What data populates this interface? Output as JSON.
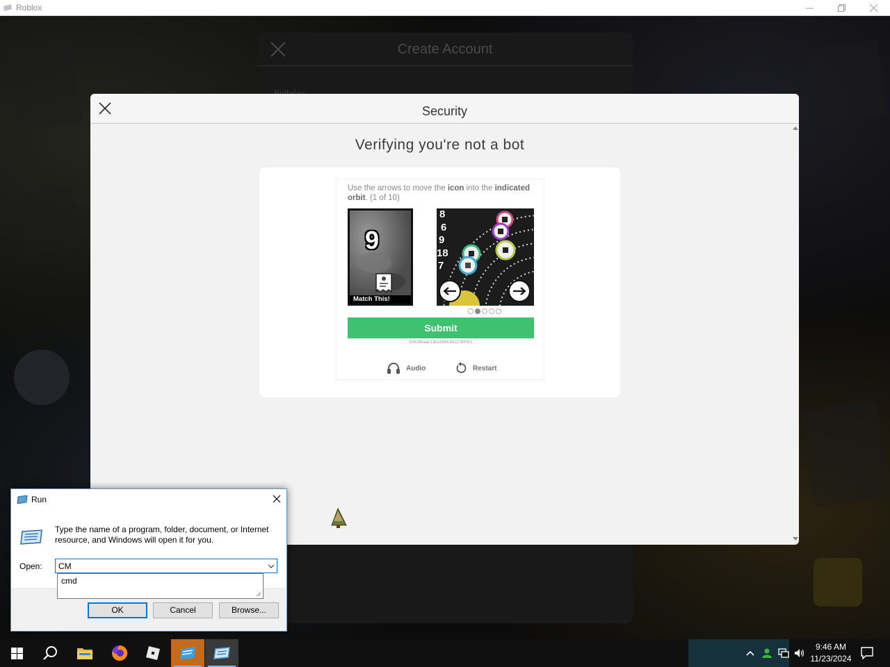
{
  "window": {
    "title": "Roblox"
  },
  "create_account": {
    "title": "Create Account",
    "field_label": "Birthday"
  },
  "security": {
    "title": "Security",
    "subtitle": "Verifying you're not a bot",
    "instruction_prefix": "Use the arrows to move the ",
    "instruction_icon_word": "icon",
    "instruction_middle": " into the ",
    "instruction_bold": "indicated orbit",
    "instruction_suffix": ". (1 of 10)",
    "match_number": "9",
    "match_caption": "Match This!",
    "orbit_numbers": [
      "8",
      "6",
      "9",
      "18",
      "7"
    ],
    "pagination": {
      "total": 5,
      "active": 1
    },
    "submit_label": "Submit",
    "session_id": "504180aae13ba1684.6411788001",
    "audio_label": "Audio",
    "restart_label": "Restart"
  },
  "run_dialog": {
    "title": "Run",
    "description": "Type the name of a program, folder, document, or Internet resource, and Windows will open it for you.",
    "open_label": "Open:",
    "input_value": "CM",
    "suggestion": "cmd",
    "ok_label": "OK",
    "cancel_label": "Cancel",
    "browse_label": "Browse..."
  },
  "taskbar": {
    "apps": [
      "start-icon",
      "search-icon",
      "file-explorer-icon",
      "firefox-icon",
      "roblox-icon",
      "roblox-studio-icon",
      "run-icon"
    ],
    "time": "9:46 AM",
    "date": "11/23/2024"
  },
  "colors": {
    "submit": "#3fc16f",
    "focus": "#0078d7",
    "taskbar": "#101010"
  }
}
